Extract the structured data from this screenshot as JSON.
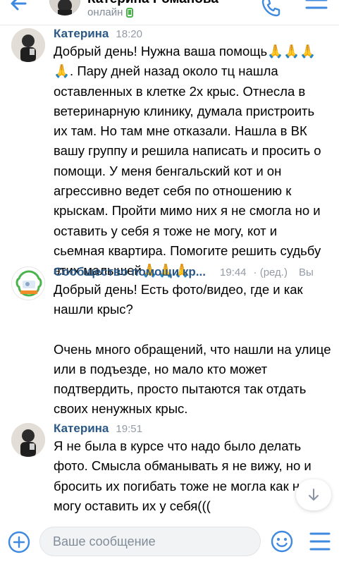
{
  "header": {
    "contact_name": "Катерина Романова",
    "status": "онлайн"
  },
  "messages": [
    {
      "author": "Катерина",
      "time": "18:20",
      "paragraphs": [
        "Добрый день! Нужна ваша помощь🙏🙏🙏🙏. Пару дней назад около тц нашла оставленных в клетке 2х крыс. Отнесла в ветеринарную клинику, думала пристроить их там. Но там мне отказали. Нашла в ВК вашу группу и решила написать и просить о помощи. У меня бенгальский кот и он агрессивно ведет себя по отношению к крыскам. Пройти мимо них я не смогла но и оставить у себя я тоже не могу, кот и сьемная квартира. Помогите решить судьбу этих малышей🙏🙏🙏"
      ]
    },
    {
      "author": "Сообщество помощи кр...",
      "time": "19:44",
      "edited": "· (ред.)",
      "extra": "Вы",
      "paragraphs": [
        "Добрый день! Есть фото/видео, где и как нашли крыс?",
        "Очень много обращений, что нашли на улице или в подъезде, но мало кто может подтвердить, просто пытаются так отдать своих ненужных крыс."
      ]
    },
    {
      "author": "Катерина",
      "time": "19:51",
      "paragraphs": [
        "Я не была в курсе что надо было делать фото. Смысла обманывать я не вижу, но и бросить их погибать тоже не могла как не могу оставить их у себя((("
      ]
    }
  ],
  "composer": {
    "placeholder": "Ваше сообщение"
  },
  "colors": {
    "accent": "#2a5885",
    "icon_blue": "#3f8ae0",
    "online_green": "#4bb34b",
    "muted": "#939ba5"
  },
  "icons": [
    "back-arrow-icon",
    "phone-icon",
    "more-icon",
    "online-phone-icon",
    "plus-icon",
    "emoji-icon",
    "menu-icon",
    "arrow-down-icon"
  ]
}
